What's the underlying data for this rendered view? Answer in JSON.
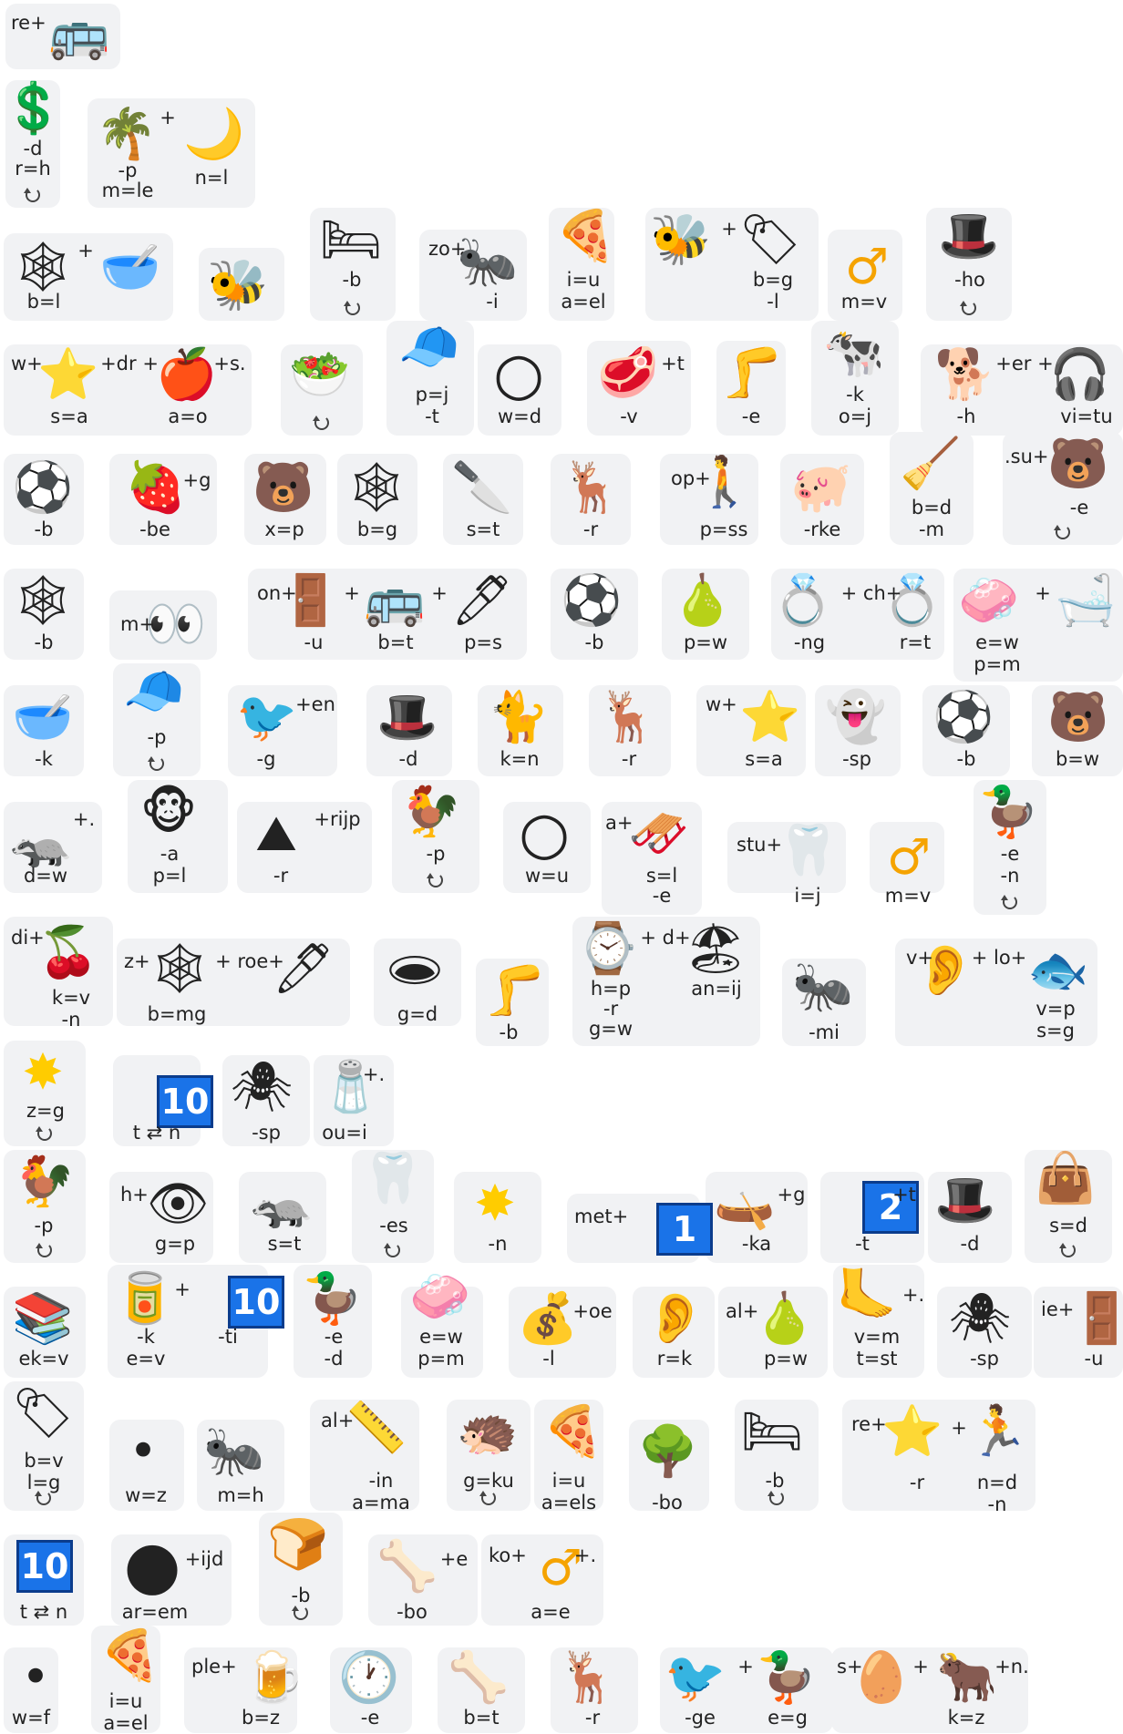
{
  "rows": [
    {
      "labels": [
        "re+"
      ],
      "icons": [
        "bus-icon"
      ]
    },
    {
      "labels": [
        "-d",
        "r=h",
        "-p",
        "m=le",
        "+",
        "n=l"
      ],
      "icons": [
        "dollar-icon",
        "palm-tree-icon",
        "moon-icon"
      ]
    },
    {
      "labels": [
        "+",
        "b=l",
        "-b",
        "zo+",
        "-i",
        "i=u",
        "a=el",
        "+",
        "b=g",
        "-l",
        "m=v",
        "-ho"
      ],
      "icons": [
        "web-icon",
        "bowl-icon",
        "bee-icon",
        "bed-icon",
        "ant-icon",
        "pizza-icon",
        "bee-icon",
        "tag-icon",
        "male-icon",
        "top-hat-icon"
      ]
    },
    {
      "labels": [
        "w+",
        "+dr +",
        "+s.",
        "s=a",
        "a=o",
        "p=j",
        "-t",
        "w=d",
        "+t",
        "-v",
        "-e",
        "-k",
        "o=j",
        "+er +",
        "-h",
        "vi=tu"
      ],
      "icons": [
        "star-icon",
        "apple-icon",
        "salad-icon",
        "cap-icon",
        "circle-icon",
        "meat-icon",
        "leg-icon",
        "cow-icon",
        "dog-icon",
        "headphones-icon"
      ]
    },
    {
      "labels": [
        "-b",
        "+g",
        "-be",
        "x=p",
        "b=g",
        "s=t",
        "-r",
        "op+",
        "p=ss",
        "-rke",
        "b=d",
        "-m",
        ".su+",
        "-e"
      ],
      "icons": [
        "soccer-icon",
        "strawberry-icon",
        "bear-icon",
        "web-icon",
        "knife-icon",
        "deer-icon",
        "person-walking-icon",
        "pig-icon",
        "broom-icon",
        "bear-face-icon"
      ]
    },
    {
      "labels": [
        "-b",
        "m+",
        "on+",
        "+",
        "+",
        "-u",
        "b=t",
        "p=s",
        "-b",
        "p=w",
        "+ ch+",
        "-ng",
        "r=t",
        "+",
        "e=w",
        "p=m"
      ],
      "icons": [
        "web-icon",
        "eyes-icon",
        "door-icon",
        "bus-icon",
        "pen-icon",
        "soccer-icon",
        "pear-icon",
        "ring-icon",
        "ring-icon",
        "soap-icon",
        "bathtub-icon"
      ]
    },
    {
      "labels": [
        "-k",
        "-p",
        "+en",
        "-g",
        "-d",
        "k=n",
        "-r",
        "w+",
        "s=a",
        "-sp",
        "-b",
        "b=w"
      ],
      "icons": [
        "bowl-icon",
        "cap-icon",
        "cardinal-icon",
        "top-hat-icon",
        "cat-icon",
        "deer-icon",
        "star-icon",
        "ghost-icon",
        "soccer-icon",
        "bear-face-icon"
      ]
    },
    {
      "labels": [
        "+.",
        "d=w",
        "-a",
        "p=l",
        "+rijp",
        "-r",
        "-p",
        "w=u",
        "a+",
        "s=l",
        "-e",
        "stu+",
        "i=j",
        "m=v",
        "-e",
        "-n"
      ],
      "icons": [
        "badger-icon",
        "monkey-icon",
        "mountain-icon",
        "rooster-icon",
        "circle-icon",
        "sled-icon",
        "tooth-icon",
        "male-icon",
        "duck-icon"
      ]
    },
    {
      "labels": [
        "di+",
        "k=v",
        "-n",
        "z+",
        "+ roe+",
        "b=mg",
        "g=d",
        "-b",
        "+ d+",
        "h=p",
        "-r",
        "g=w",
        "an=ij",
        "-mi",
        "v+",
        "+ lo+",
        "v=p",
        "s=g"
      ],
      "icons": [
        "cherries-icon",
        "web-icon",
        "pen-icon",
        "hole-icon",
        "leg-icon",
        "watch-icon",
        "beach-icon",
        "ant-icon",
        "ear-icon",
        "fish-icon"
      ]
    },
    {
      "labels": [
        "z=g",
        "10",
        "t ⇄ n",
        "-sp",
        "+.",
        "ou=i"
      ],
      "icons": [
        "sun-icon",
        "spider-icon",
        "salt-icon"
      ]
    },
    {
      "labels": [
        "-p",
        "h+",
        "g=p",
        "s=t",
        "-es",
        "-n",
        "met+",
        "1",
        "+g",
        "-ka",
        "2",
        "+t",
        "-t",
        "-d",
        "s=d"
      ],
      "icons": [
        "rooster-icon",
        "eye-icon",
        "badger-icon",
        "tooth-icon",
        "sun-icon",
        "canoe-icon",
        "top-hat-icon",
        "handbag-icon"
      ]
    },
    {
      "labels": [
        "ek=v",
        "+",
        "10",
        "-k",
        "e=v",
        "-ti",
        "-e",
        "-d",
        "e=w",
        "p=m",
        "+oe",
        "-l",
        "r=k",
        "al+",
        "p=w",
        "+.",
        "v=m",
        "t=st",
        "-sp",
        "ie+",
        "-u"
      ],
      "icons": [
        "books-icon",
        "can-icon",
        "duck-icon",
        "soap-icon",
        "money-bag-icon",
        "ear-icon",
        "pear-icon",
        "foot-icon",
        "spider-icon",
        "door-icon"
      ]
    },
    {
      "labels": [
        "b=v",
        "l=g",
        "w=z",
        "m=h",
        "al+",
        "-in",
        "a=ma",
        "g=ku",
        "i=u",
        "a=els",
        "-bo",
        "-b",
        "re+",
        "+",
        "-r",
        "n=d",
        "-n"
      ],
      "icons": [
        "tag-icon",
        "wine-icon",
        "ant-icon",
        "ruler-icon",
        "hedgehog-icon",
        "pizza-icon",
        "tree-icon",
        "bed-icon",
        "star-icon",
        "runner-icon"
      ]
    },
    {
      "labels": [
        "10",
        "t ⇄ n",
        "+ijd",
        "ar=em",
        "-b",
        "+e",
        "-bo",
        "ko+",
        "+.",
        "a=e"
      ],
      "icons": [
        "black-circle-icon",
        "bread-icon",
        "bone-icon",
        "male-icon"
      ]
    },
    {
      "labels": [
        "w=f",
        "i=u",
        "a=el",
        "ple+",
        "b=z",
        "-e",
        "b=t",
        "-r",
        "+",
        "-ge",
        "e=g",
        "s+",
        "+",
        "+n.",
        "k=z"
      ],
      "icons": [
        "wine-icon",
        "pizza-icon",
        "beer-icon",
        "clock-icon",
        "bone-icon",
        "deer-icon",
        "cardinal-icon",
        "duck-icon",
        "egg-icon",
        "ox-icon"
      ]
    }
  ]
}
